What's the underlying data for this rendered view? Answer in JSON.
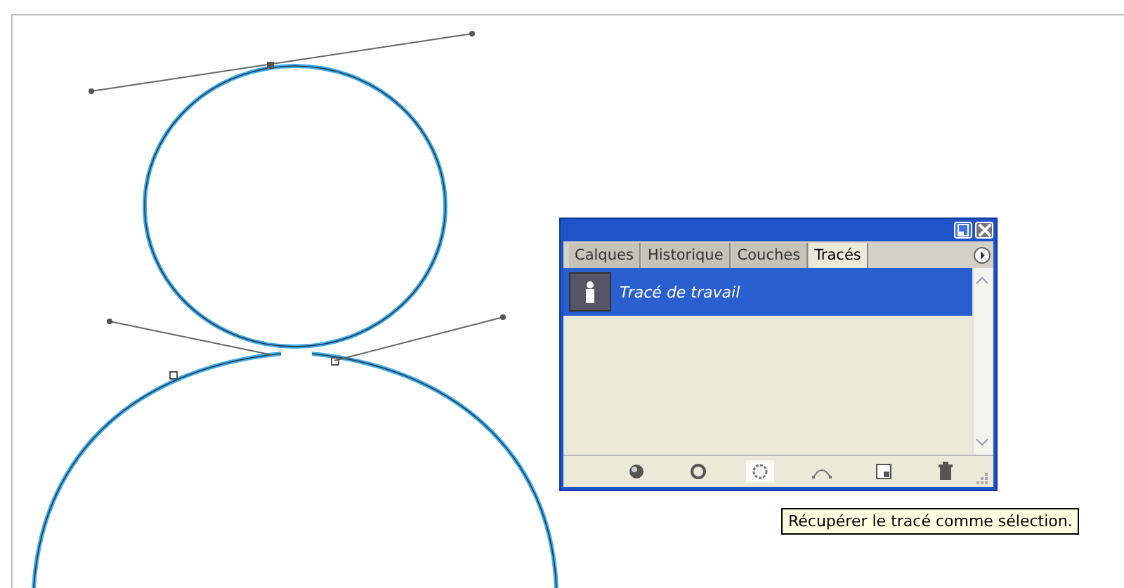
{
  "panel": {
    "tabs": [
      {
        "label": "Calques",
        "selected": false
      },
      {
        "label": "Historique",
        "selected": false
      },
      {
        "label": "Couches",
        "selected": false
      },
      {
        "label": "Tracés",
        "selected": true
      }
    ],
    "paths": [
      {
        "name": "Tracé de travail",
        "selected": true
      }
    ],
    "tools": [
      {
        "kind": "fill",
        "pressed": false
      },
      {
        "kind": "stroke",
        "pressed": false
      },
      {
        "kind": "selection",
        "pressed": true
      },
      {
        "kind": "workpath",
        "pressed": false
      },
      {
        "kind": "new",
        "pressed": false
      },
      {
        "kind": "trash",
        "pressed": false
      }
    ]
  },
  "tooltip": {
    "text": "Récupérer le tracé comme sélection."
  }
}
